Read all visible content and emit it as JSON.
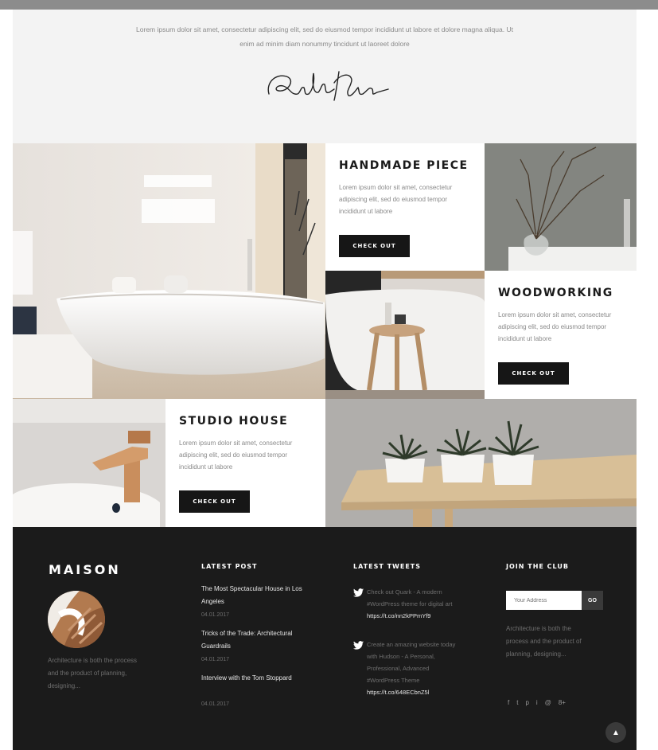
{
  "intro": {
    "text": "Lorem ipsum dolor sit amet, consectetur adipiscing elit, sed do eiusmod tempor incididunt ut labore et dolore magna aliqua. Ut enim ad minim diam nonummy tincidunt ut laoreet dolore",
    "signature": "Richard Nixon"
  },
  "cards": [
    {
      "title": "HANDMADE PIECE",
      "text": "Lorem ipsum dolor sit amet, consectetur adipiscing elit, sed do eiusmod tempor incididunt ut labore",
      "button": "CHECK OUT"
    },
    {
      "title": "WOODWORKING",
      "text": "Lorem ipsum dolor sit amet, consectetur adipiscing elit, sed do eiusmod tempor incididunt ut labore",
      "button": "CHECK OUT"
    },
    {
      "title": "STUDIO HOUSE",
      "text": "Lorem ipsum dolor sit amet, consectetur adipiscing elit, sed do eiusmod tempor incididunt ut labore",
      "button": "CHECK OUT"
    }
  ],
  "footer": {
    "brand": "MAISON",
    "about": "Architecture is both the process and the product of planning, designing...",
    "latest_post": {
      "heading": "LATEST POST",
      "posts": [
        {
          "title": "The Most Spectacular House in Los Angeles",
          "date": "04.01.2017"
        },
        {
          "title": "Tricks of the Trade: Architectural Guardrails",
          "date": "04.01.2017"
        },
        {
          "title": "Interview with the Tom Stoppard",
          "date": "04.01.2017"
        }
      ]
    },
    "latest_tweets": {
      "heading": "LATEST TWEETS",
      "tweets": [
        {
          "text": "Check out Quark - A modern #WordPress theme for digital art",
          "link": "https://t.co/nn2kPPmYf9"
        },
        {
          "text": "Create an amazing website today with Hudson - A Personal, Professional, Advanced #WordPress Theme",
          "link": "https://t.co/648ECbnZ5l"
        }
      ]
    },
    "club": {
      "heading": "JOIN THE CLUB",
      "placeholder": "Your Address",
      "button": "GO",
      "text": "Architecture is both the process and the product of planning, designing...",
      "socials": [
        "f",
        "t",
        "p",
        "i",
        "@",
        "8+"
      ]
    }
  },
  "icons": [
    "twitter-icon",
    "facebook-icon",
    "pinterest-icon",
    "instagram-icon",
    "dribbble-icon",
    "google-plus-icon",
    "arrow-up-icon"
  ],
  "colors": {
    "footer_bg": "#1b1b1b",
    "button_bg": "#161616",
    "page_bg": "#f3f3f3"
  }
}
